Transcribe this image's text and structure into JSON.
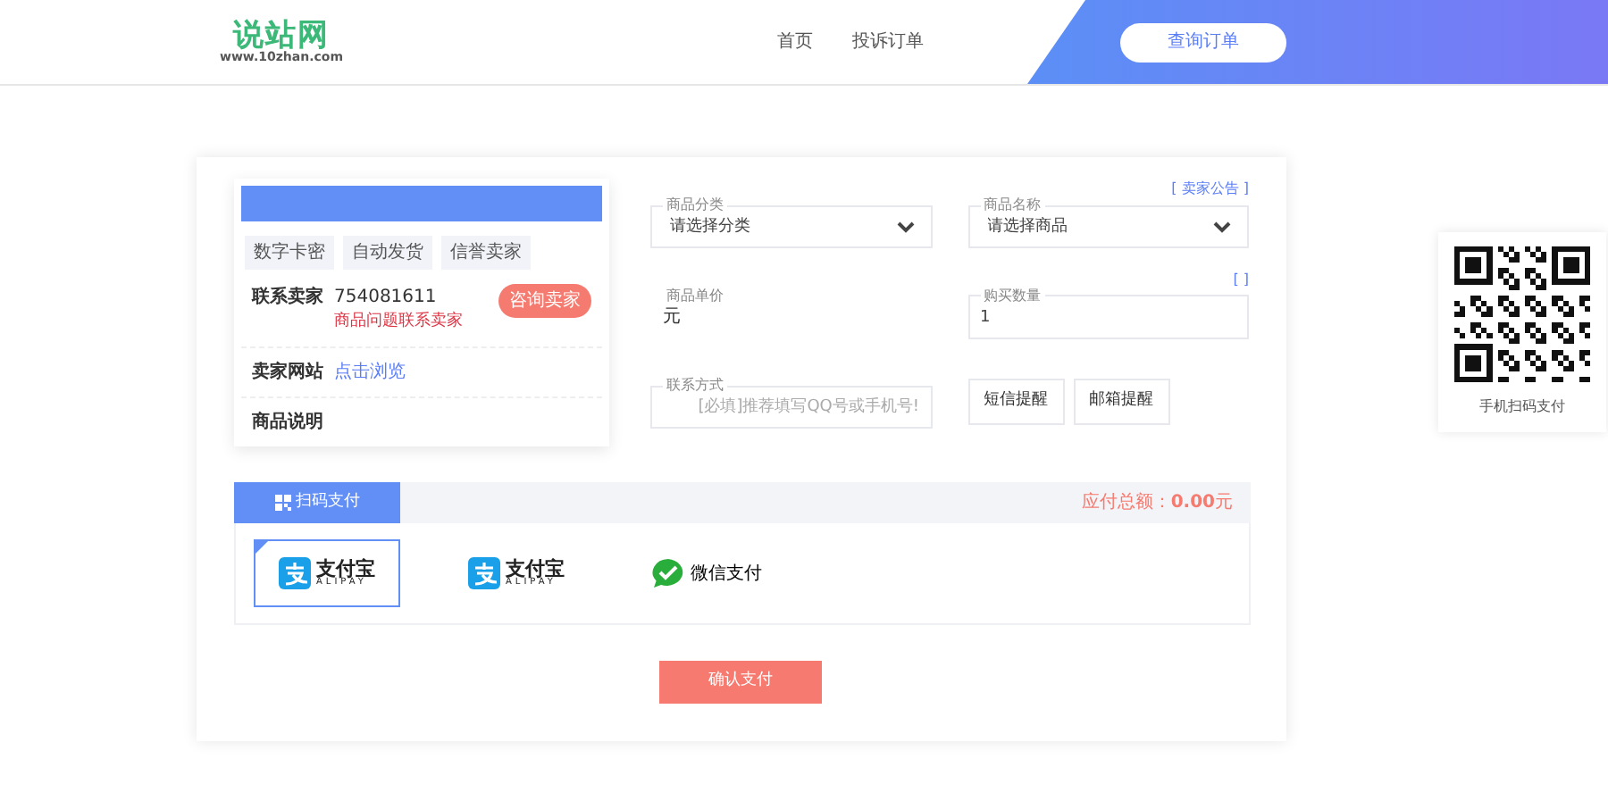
{
  "header": {
    "logo": {
      "title": "说站网",
      "subtitle": "www.10zhan.com"
    },
    "nav": [
      {
        "label": "首页"
      },
      {
        "label": "投诉订单"
      }
    ],
    "query_button": "查询订单"
  },
  "seller": {
    "tags": [
      "数字卡密",
      "自动发货",
      "信誉卖家"
    ],
    "rows": [
      {
        "kind": "contact",
        "label": "联系卖家",
        "value": "754081611",
        "note": "商品问题联系卖家",
        "button": "咨询卖家"
      },
      {
        "kind": "link",
        "label": "卖家网站",
        "value": "点击浏览"
      },
      {
        "kind": "text",
        "label": "商品说明"
      }
    ]
  },
  "form": {
    "fields": [
      {
        "kind": "select",
        "label": "商品分类",
        "value": "请选择分类"
      },
      {
        "kind": "select",
        "label": "商品名称",
        "value": "请选择商品",
        "note": "[ 卖家公告 ]"
      },
      {
        "kind": "static",
        "label": "商品单价",
        "value": "元"
      },
      {
        "kind": "input",
        "label": "购买数量",
        "value": "1",
        "note": "[ ]"
      },
      {
        "kind": "input",
        "label": "联系方式",
        "placeholder": "[必填]推荐填写QQ号或手机号!"
      },
      {
        "kind": "buttons",
        "buttons": [
          "短信提醒",
          "邮箱提醒"
        ]
      }
    ]
  },
  "payment": {
    "tabs": [
      {
        "label": "扫码支付",
        "selected": true
      }
    ],
    "total": "应付总额：**0.00**元",
    "methods": [
      {
        "kind": "alipay",
        "name": "支付宝",
        "sub": "ALIPAY",
        "selected": true
      },
      {
        "kind": "alipay",
        "name": "支付宝",
        "sub": "ALIPAY",
        "selected": false
      },
      {
        "kind": "wechat",
        "name": "微信支付",
        "selected": false
      }
    ]
  },
  "confirm_button": "确认支付",
  "qr_panel": {
    "caption": "手机扫码支付"
  }
}
